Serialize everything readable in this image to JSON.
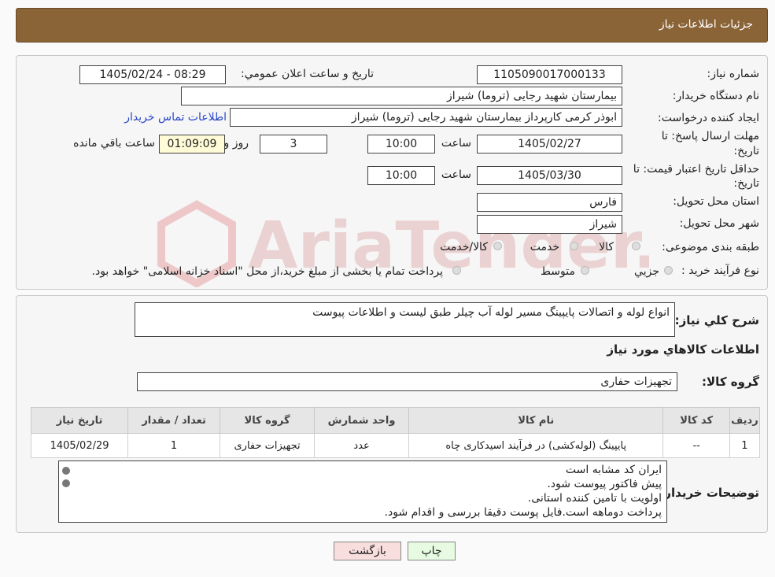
{
  "header": {
    "title": "جزئیات اطلاعات نیاز"
  },
  "form": {
    "need_number_label": "شماره نیاز:",
    "need_number": "1105090017000133",
    "announce_label": "تاریخ و ساعت اعلان عمومي:",
    "announce_value": "1405/02/24 - 08:29",
    "buyer_org_label": "نام دستگاه خريدار:",
    "buyer_org": "بیمارستان شهید رجایی (تروما) شیراز",
    "requester_label": "ايجاد کننده درخواست:",
    "requester": "ابوذر کرمی کارپرداز بیمارستان شهید رجایی (تروما) شیراز",
    "contact_link": "اطلاعات تماس خريدار",
    "deadline_label_1": "مهلت ارسال پاسخ: تا",
    "deadline_label_2": "تاريخ:",
    "deadline_date": "1405/02/27",
    "hour_label": "ساعت",
    "deadline_time": "10:00",
    "days_value": "3",
    "days_label": "روز و",
    "remaining_time": "01:09:09",
    "remaining_label": "ساعت باقي مانده",
    "validity_label_1": "حداقل تاريخ اعتبار قيمت: تا",
    "validity_label_2": "تاريخ:",
    "validity_date": "1405/03/30",
    "validity_time": "10:00",
    "province_label": "استان محل تحويل:",
    "province": "فارس",
    "city_label": "شهر محل تحويل:",
    "city": "شيراز",
    "category_label": "طبقه بندی موضوعی:",
    "category_options": [
      "کالا",
      "خدمت",
      "کالا/خدمت"
    ],
    "process_label": "نوع فرآيند خريد :",
    "process_options": [
      "جزيي",
      "متوسط"
    ],
    "process_note": "پرداخت تمام يا بخشی از مبلغ خريد،از محل \"اسناد خزانه اسلامی\" خواهد بود."
  },
  "details": {
    "description_label": "شرح کلي نياز:",
    "description": "انواع لوله و اتصالات پایپینگ مسیر لوله آب چیلر طبق لیست و اطلاعات پیوست",
    "goods_info_title": "اطلاعات کالاهاي مورد نياز",
    "goods_group_label": "گروه کالا:",
    "goods_group": "تجهیزات حفاری",
    "table": {
      "headers": [
        "رديف",
        "کد کالا",
        "نام کالا",
        "واحد شمارش",
        "گروه کالا",
        "تعداد / مقدار",
        "تاريخ نياز"
      ],
      "rows": [
        [
          "1",
          "--",
          "پایپینگ (لوله‌کشی) در فرآیند اسیدکاری چاه",
          "عدد",
          "تجهیزات حفاری",
          "1",
          "1405/02/29"
        ]
      ]
    },
    "buyer_notes_label": "توضيحات خريدار:",
    "buyer_notes": [
      "ایران کد مشابه است",
      "پیش فاکتور پیوست شود.",
      "اولویت با تامین کننده استانی.",
      "پرداخت دوماهه است.فایل پوست دقیقا بررسی و اقدام شود."
    ]
  },
  "watermark": {
    "text": "AriaTender.neT"
  },
  "buttons": {
    "print": "چاپ",
    "back": "بازگشت"
  }
}
